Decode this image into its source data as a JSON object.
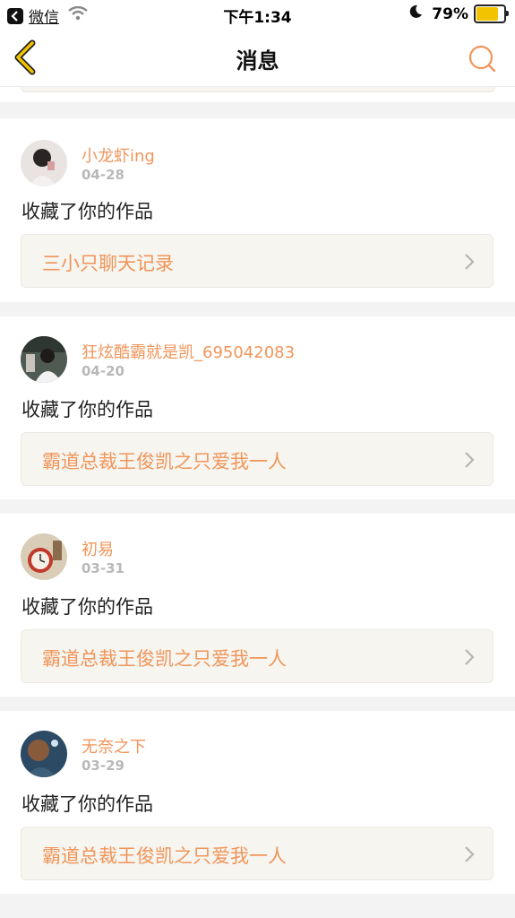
{
  "status_bar": {
    "back_app_label": "微信",
    "time": "下午1:34",
    "battery_text": "79%",
    "battery_percent": 79,
    "battery_color": "#f2c300"
  },
  "nav": {
    "title": "消息",
    "back_icon": "chevron-left-icon",
    "search_icon": "search-icon",
    "accent_color": "#f0955a"
  },
  "notifications": [
    {
      "user": "小龙虾ing",
      "date": "04-28",
      "action": "收藏了你的作品",
      "work": "三小只聊天记录",
      "avatar": "avatar-photo"
    },
    {
      "user": "狂炫酷霸就是凯_695042083",
      "date": "04-20",
      "action": "收藏了你的作品",
      "work": "霸道总裁王俊凯之只爱我一人",
      "avatar": "avatar-photo"
    },
    {
      "user": "初易",
      "date": "03-31",
      "action": "收藏了你的作品",
      "work": "霸道总裁王俊凯之只爱我一人",
      "avatar": "avatar-photo"
    },
    {
      "user": "无奈之下",
      "date": "03-29",
      "action": "收藏了你的作品",
      "work": "霸道总裁王俊凯之只爱我一人",
      "avatar": "avatar-photo"
    }
  ]
}
